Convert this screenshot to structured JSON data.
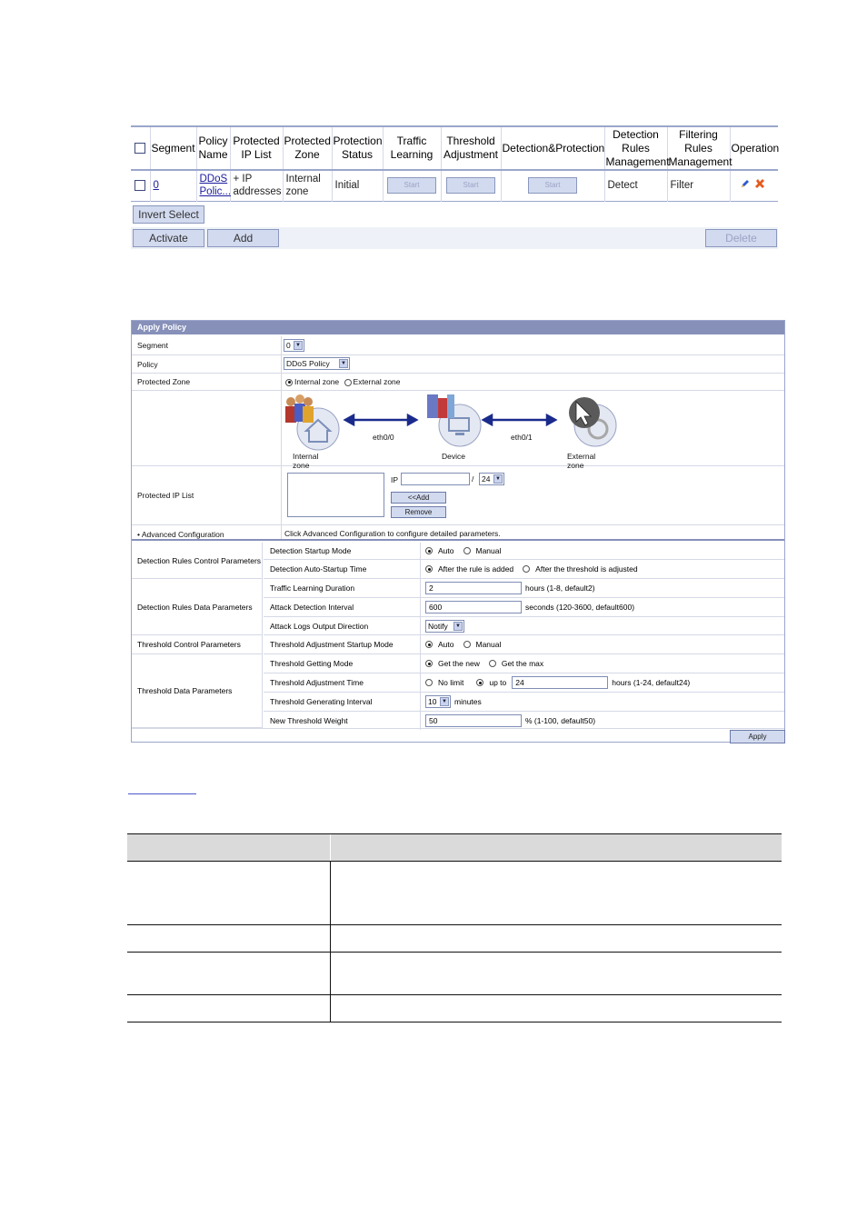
{
  "policy_list": {
    "headers": [
      "Segment",
      "Policy Name",
      "Protected IP List",
      "Protected Zone",
      "Protection Status",
      "Traffic Learning",
      "Threshold Adjustment",
      "Detection&Protection",
      "Detection Rules Management",
      "Filtering Rules Management",
      "Operation"
    ],
    "row": {
      "segment": "0",
      "policy_name": "DDoS Polic...",
      "ip_list": "+ IP addresses",
      "zone": "Internal zone",
      "status": "Initial",
      "traffic_start": "Start",
      "threshold_start": "Start",
      "detection_start": "Start",
      "detection_rules": "Detect",
      "filtering_rules": "Filter",
      "icons": [
        "edit-icon",
        "delete-icon"
      ]
    },
    "invert_select": "Invert Select",
    "activate": "Activate",
    "add": "Add",
    "delete": "Delete"
  },
  "apply_policy": {
    "title": "Apply Policy",
    "segment_label": "Segment",
    "segment_value": "0",
    "policy_label": "Policy",
    "policy_value": "DDoS Policy",
    "zone_label": "Protected Zone",
    "zone_internal": "Internal zone",
    "zone_external": "External zone",
    "diagram": {
      "internal_zone": "Internal zone",
      "device": "Device",
      "external_zone": "External zone",
      "eth0": "eth0/0",
      "eth1": "eth0/1"
    },
    "ip_list_label": "Protected IP List",
    "ip_label": "IP",
    "ip_value": "",
    "slash": "/",
    "mask_value": "24",
    "add_btn": "<<Add",
    "remove_btn": "Remove",
    "advanced_label": "• Advanced Configuration",
    "advanced_hint": "Click Advanced Configuration to configure detailed parameters.",
    "groups": {
      "g1": "Detection Rules Control Parameters",
      "g2": "Detection Rules Data Parameters",
      "g3": "Threshold Control Parameters",
      "g4": "Threshold Data Parameters"
    },
    "rows": {
      "startup_mode": "Detection Startup Mode",
      "startup_auto": "Auto",
      "startup_manual": "Manual",
      "auto_startup_time": "Detection Auto-Startup Time",
      "after_rule": "After the rule is added",
      "after_threshold": "After the threshold is adjusted",
      "learning_duration": "Traffic Learning Duration",
      "learning_value": "2",
      "learning_unit": "hours (1-8, default2)",
      "attack_interval": "Attack Detection Interval",
      "attack_value": "600",
      "attack_unit": "seconds (120-3600, default600)",
      "logs_direction": "Attack Logs Output Direction",
      "logs_value": "Notify",
      "threshold_mode": "Threshold Adjustment Startup Mode",
      "threshold_auto": "Auto",
      "threshold_manual": "Manual",
      "getting_mode": "Threshold Getting Mode",
      "get_new": "Get the new",
      "get_max": "Get the max",
      "adjust_time": "Threshold Adjustment Time",
      "no_limit": "No limit",
      "up_to": "up to",
      "adjust_value": "24",
      "adjust_unit": "hours (1-24, default24)",
      "gen_interval": "Threshold Generating Interval",
      "gen_value": "10",
      "gen_unit": "minutes",
      "weight": "New Threshold Weight",
      "weight_value": "50",
      "weight_unit": "% (1-100, default50)"
    },
    "apply_btn": "Apply"
  },
  "colors": {
    "header_bar": "#8690b9",
    "button_fill": "#d2daef",
    "border": "#9aa6cc"
  }
}
